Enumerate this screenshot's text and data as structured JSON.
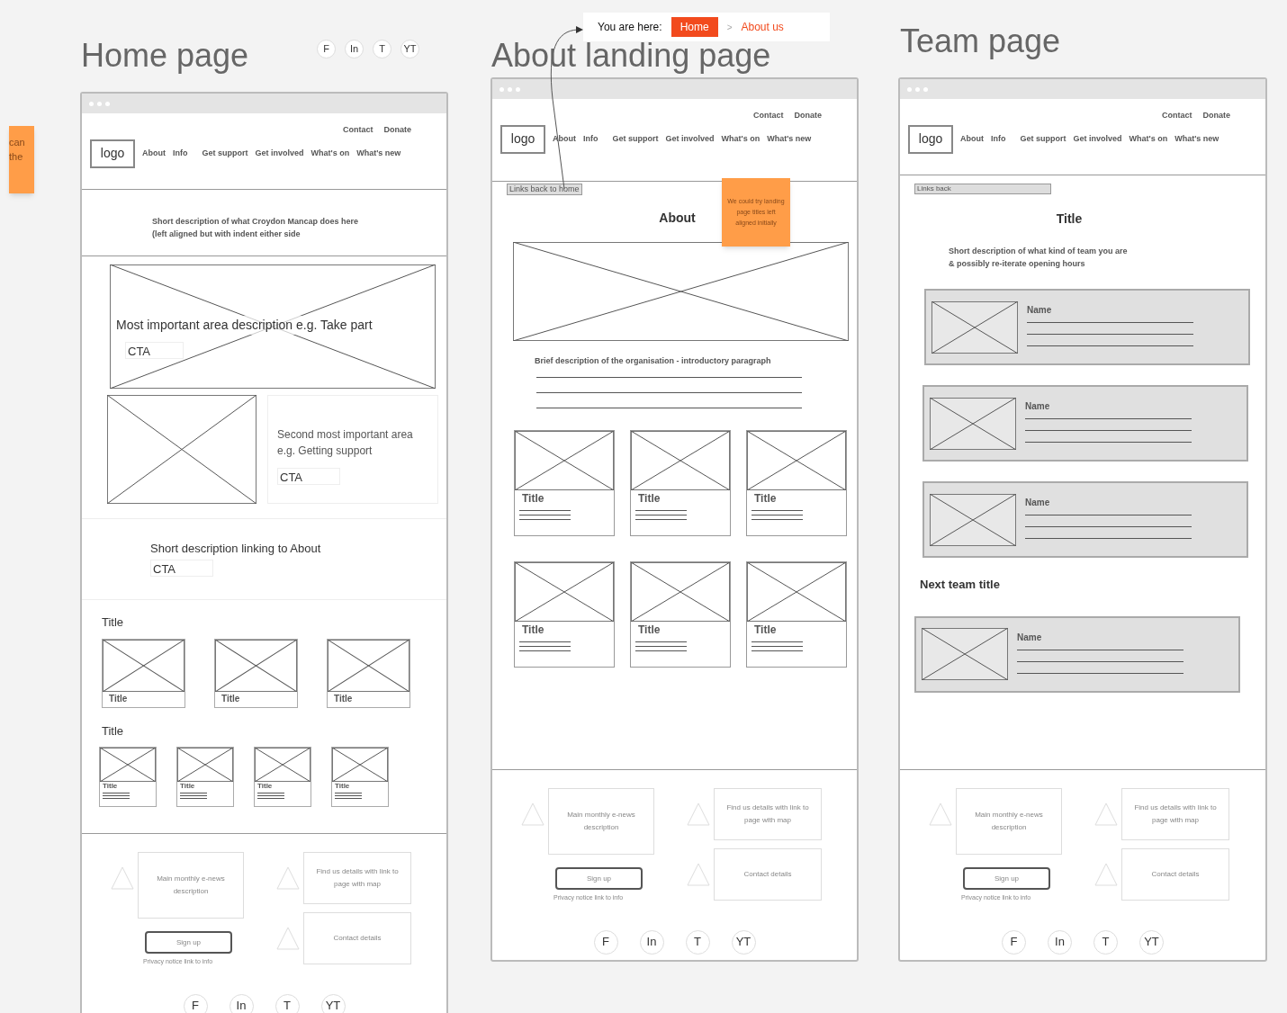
{
  "edge_note": {
    "lines": [
      "can",
      "the"
    ]
  },
  "breadcrumb": {
    "prefix": "You are here:",
    "separator": ">",
    "items": [
      {
        "label": "Home",
        "selected": true
      },
      {
        "label": "About us",
        "selected": false
      }
    ]
  },
  "boards": [
    {
      "kind": "home",
      "title": "Home page",
      "social": [
        "F",
        "In",
        "T",
        "YT"
      ],
      "header": {
        "top_links": [
          "Contact",
          "Donate"
        ],
        "logo": "logo",
        "nav": [
          "About",
          "Info",
          "Get support",
          "Get involved",
          "What's on",
          "What's new"
        ]
      },
      "intro": [
        "Short description of what Croydon Mancap does here",
        "(left aligned but with indent either side"
      ],
      "hero": {
        "text": "Most important area description e.g. Take part",
        "cta": "CTA"
      },
      "second": {
        "text": "Second most important area e.g. Getting support",
        "cta": "CTA"
      },
      "about_link": {
        "text": "Short description linking to About",
        "cta": "CTA"
      },
      "sections": [
        {
          "title": "Title",
          "kind": "large",
          "cards": [
            "Title",
            "Title",
            "Title"
          ]
        },
        {
          "title": "Title",
          "kind": "small",
          "cards": [
            "Title",
            "Title",
            "Title",
            "Title"
          ]
        }
      ],
      "footer": {
        "newsletter": "Main monthly e-news description",
        "signup": "Sign up",
        "privacy": "Privacy notice link to info",
        "find_us": "Find us details with link to page with map",
        "contact": "Contact details",
        "social": [
          "F",
          "In",
          "T",
          "YT"
        ]
      }
    },
    {
      "kind": "about",
      "title": "About landing page",
      "header": {
        "top_links": [
          "Contact",
          "Donate"
        ],
        "logo": "logo",
        "nav": [
          "About",
          "Info",
          "Get support",
          "Get involved",
          "What's on",
          "What's new"
        ]
      },
      "links_back": "Links back to home",
      "heading": "About",
      "note": "We could try landing page titles left aligned initially",
      "description": "Brief description of the organisation - introductory paragraph",
      "cards": [
        "Title",
        "Title",
        "Title",
        "Title",
        "Title",
        "Title"
      ],
      "footer": {
        "newsletter": "Main monthly e-news description",
        "signup": "Sign up",
        "privacy": "Privacy notice link to info",
        "find_us": "Find us details with link to page with map",
        "contact": "Contact details",
        "social": [
          "F",
          "In",
          "T",
          "YT"
        ]
      }
    },
    {
      "kind": "team",
      "title": "Team page",
      "header": {
        "top_links": [
          "Contact",
          "Donate"
        ],
        "logo": "logo",
        "nav": [
          "About",
          "Info",
          "Get support",
          "Get involved",
          "What's on",
          "What's new"
        ]
      },
      "links_back": "Links back",
      "heading": "Title",
      "description": [
        "Short description of what kind of team you are",
        "& possibly re-iterate opening hours"
      ],
      "groups": [
        {
          "members": [
            "Name",
            "Name",
            "Name"
          ]
        },
        {
          "title": "Next team title",
          "members": [
            "Name"
          ]
        }
      ],
      "footer": {
        "newsletter": "Main monthly e-news description",
        "signup": "Sign up",
        "privacy": "Privacy notice link to info",
        "find_us": "Find us details with link to page with map",
        "contact": "Contact details",
        "social": [
          "F",
          "In",
          "T",
          "YT"
        ]
      }
    }
  ]
}
